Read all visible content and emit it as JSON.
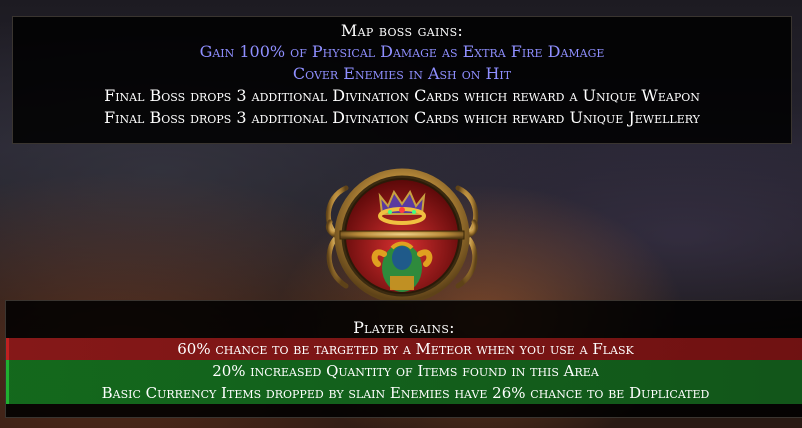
{
  "boss": {
    "header": "Map boss gains:",
    "mods": [
      {
        "text": "Gain 100% of Physical Damage as Extra Fire Damage",
        "color": "#8f8fff"
      },
      {
        "text": "Cover Enemies in Ash on Hit",
        "color": "#8f8fff"
      },
      {
        "text": "Final Boss drops 3 additional Divination Cards which reward a Unique Weapon",
        "color": "#ffffff"
      },
      {
        "text": "Final Boss drops 3 additional Divination Cards which reward Unique Jewellery",
        "color": "#ffffff"
      }
    ]
  },
  "emblem": {
    "top_icon": "crown-icon",
    "bottom_icon": "cursed-figure-icon"
  },
  "player": {
    "header": "Player gains:",
    "mods": [
      {
        "text": "60% chance to be targeted by a Meteor when you use a Flask",
        "status": "negative",
        "color": "#8c1919"
      },
      {
        "text": "20% increased Quantity of Items found in this Area",
        "status": "positive",
        "color": "#146e1e"
      },
      {
        "text": "Basic Currency Items dropped by slain Enemies have 26% chance to be Duplicated",
        "status": "positive",
        "color": "#146e1e"
      }
    ]
  }
}
